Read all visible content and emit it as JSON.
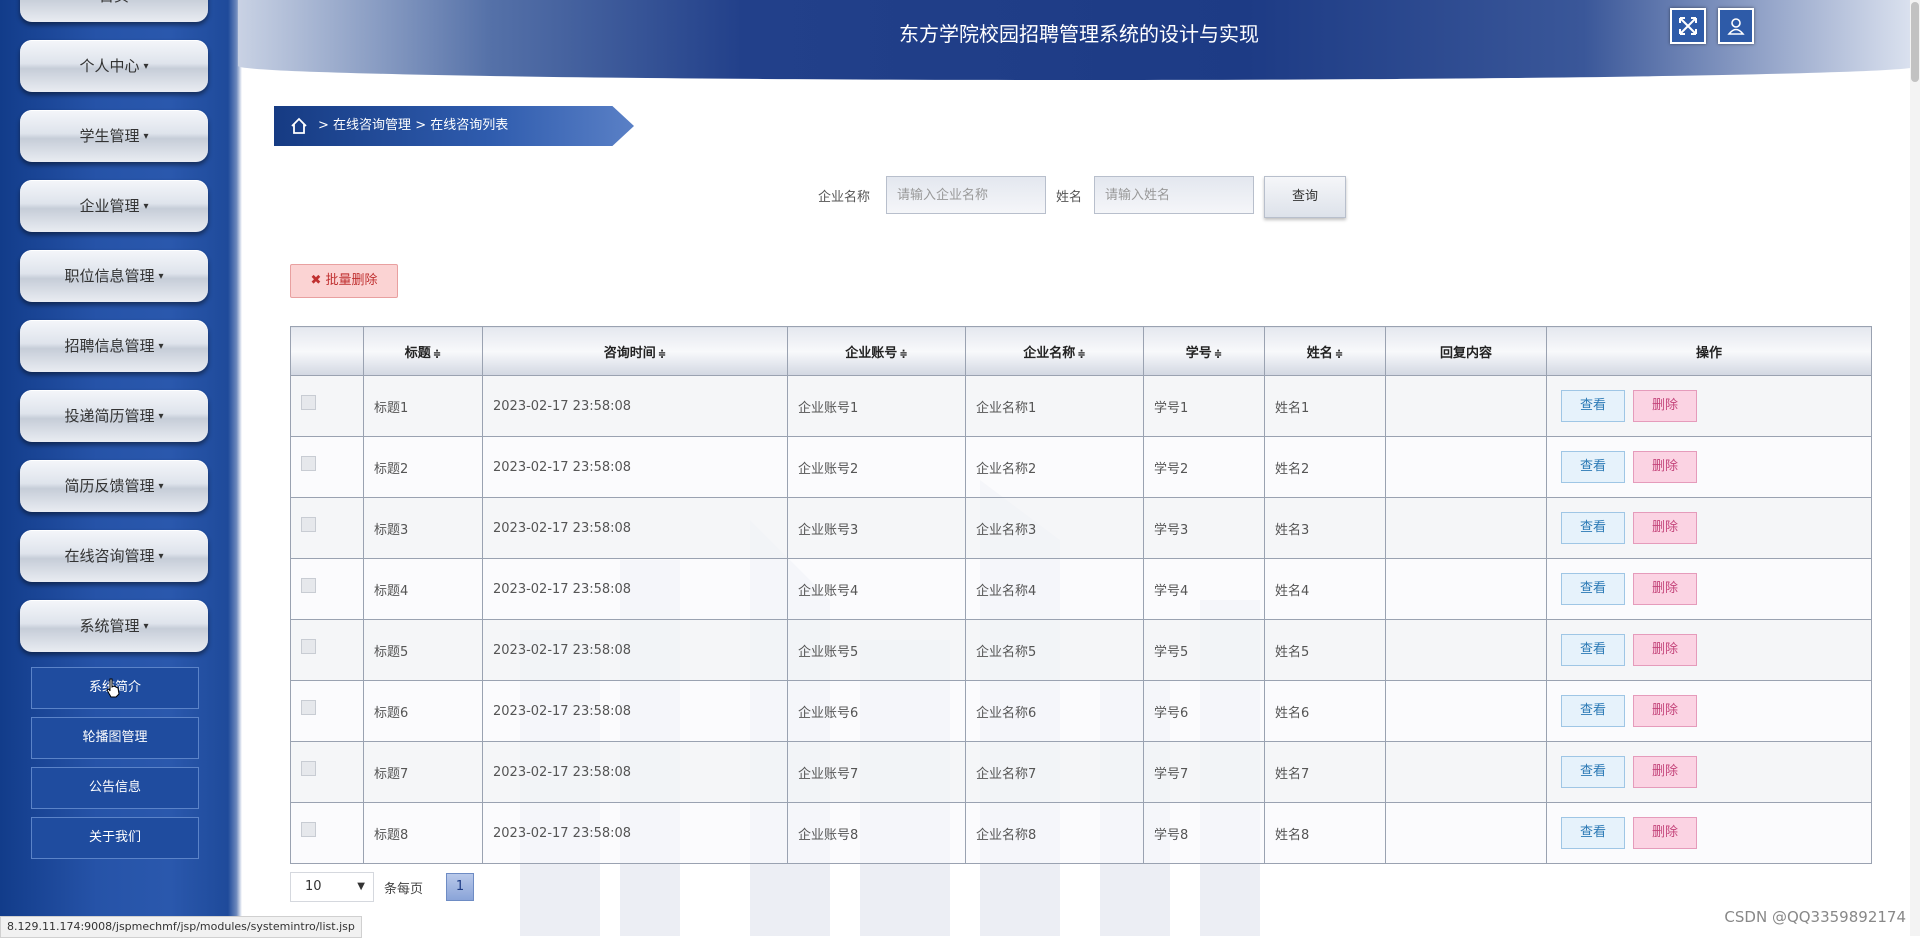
{
  "app": {
    "title": "东方学院校园招聘管理系统的设计与实现"
  },
  "header": {
    "fullscreen_icon": "fullscreen-icon",
    "user_icon": "user-icon"
  },
  "sidebar": {
    "top_partial": "首页",
    "menus": [
      {
        "label": "个人中心"
      },
      {
        "label": "学生管理"
      },
      {
        "label": "企业管理"
      },
      {
        "label": "职位信息管理"
      },
      {
        "label": "招聘信息管理"
      },
      {
        "label": "投递简历管理"
      },
      {
        "label": "简历反馈管理"
      },
      {
        "label": "在线咨询管理"
      },
      {
        "label": "系统管理"
      }
    ],
    "submenu": [
      {
        "label": "系统简介"
      },
      {
        "label": "轮播图管理"
      },
      {
        "label": "公告信息"
      },
      {
        "label": "关于我们"
      }
    ],
    "caret": "▾"
  },
  "breadcrumb": {
    "items": [
      "在线咨询管理",
      "在线咨询列表"
    ],
    "sep": ">"
  },
  "search": {
    "company_label": "企业名称",
    "company_placeholder": "请输入企业名称",
    "name_label": "姓名",
    "name_placeholder": "请输入姓名",
    "button": "查询"
  },
  "toolbar": {
    "batch_delete": "批量删除"
  },
  "table": {
    "headers": [
      "标题",
      "咨询时间",
      "企业账号",
      "企业名称",
      "学号",
      "姓名",
      "回复内容",
      "操作"
    ],
    "sort_icon": "≑",
    "view_label": "查看",
    "delete_label": "删除",
    "rows": [
      {
        "title": "标题1",
        "time": "2023-02-17 23:58:08",
        "account": "企业账号1",
        "company": "企业名称1",
        "sid": "学号1",
        "name": "姓名1",
        "reply": ""
      },
      {
        "title": "标题2",
        "time": "2023-02-17 23:58:08",
        "account": "企业账号2",
        "company": "企业名称2",
        "sid": "学号2",
        "name": "姓名2",
        "reply": ""
      },
      {
        "title": "标题3",
        "time": "2023-02-17 23:58:08",
        "account": "企业账号3",
        "company": "企业名称3",
        "sid": "学号3",
        "name": "姓名3",
        "reply": ""
      },
      {
        "title": "标题4",
        "time": "2023-02-17 23:58:08",
        "account": "企业账号4",
        "company": "企业名称4",
        "sid": "学号4",
        "name": "姓名4",
        "reply": ""
      },
      {
        "title": "标题5",
        "time": "2023-02-17 23:58:08",
        "account": "企业账号5",
        "company": "企业名称5",
        "sid": "学号5",
        "name": "姓名5",
        "reply": ""
      },
      {
        "title": "标题6",
        "time": "2023-02-17 23:58:08",
        "account": "企业账号6",
        "company": "企业名称6",
        "sid": "学号6",
        "name": "姓名6",
        "reply": ""
      },
      {
        "title": "标题7",
        "time": "2023-02-17 23:58:08",
        "account": "企业账号7",
        "company": "企业名称7",
        "sid": "学号7",
        "name": "姓名7",
        "reply": ""
      },
      {
        "title": "标题8",
        "time": "2023-02-17 23:58:08",
        "account": "企业账号8",
        "company": "企业名称8",
        "sid": "学号8",
        "name": "姓名8",
        "reply": ""
      }
    ]
  },
  "pagination": {
    "page_size": "10",
    "per_page_label": "条每页",
    "current_page": "1"
  },
  "statusbar": {
    "url": "8.129.11.174:9008/jspmechmf/jsp/modules/systemintro/list.jsp"
  },
  "watermark": "CSDN @QQ3359892174",
  "colors": {
    "primary": "#1d3b85",
    "danger": "#c03030",
    "view": "#2b79b5"
  }
}
